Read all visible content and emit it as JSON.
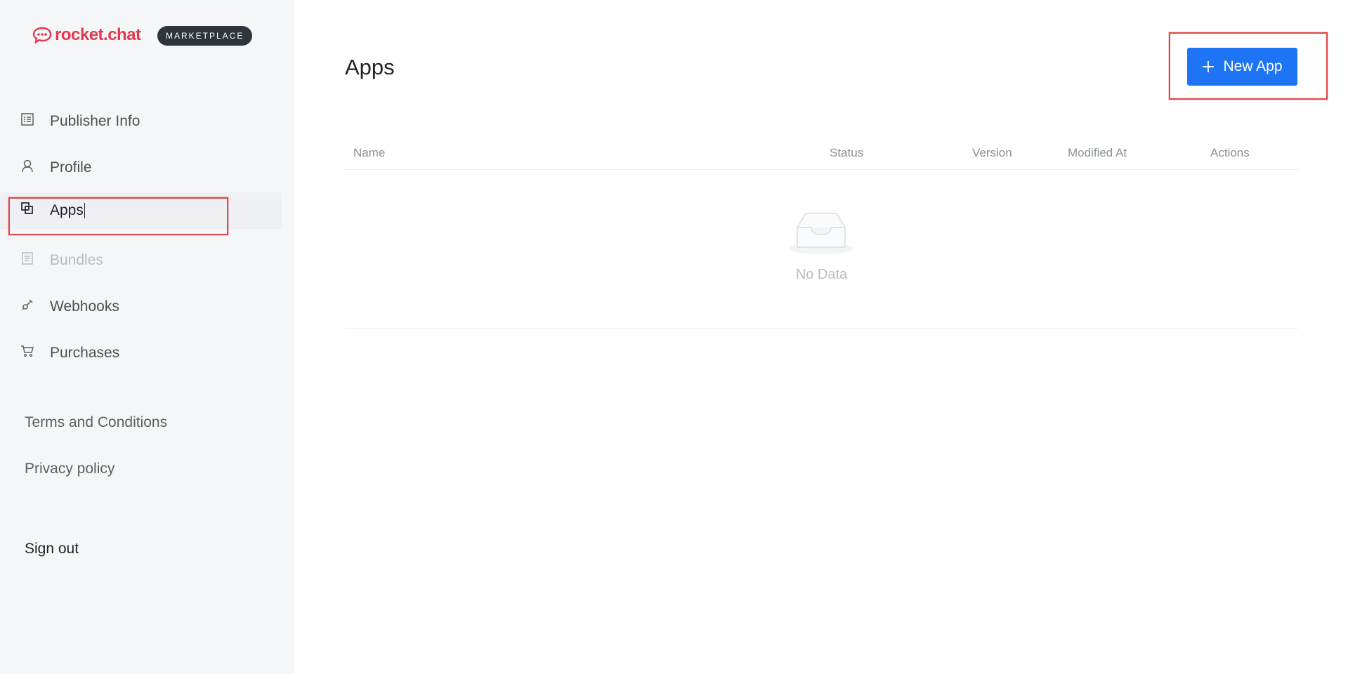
{
  "brand": {
    "logo_text": "rocket.chat",
    "badge": "MARKETPLACE",
    "accent": "#e5384f"
  },
  "sidebar": {
    "items": [
      {
        "label": "Publisher Info",
        "icon": "document-list-icon",
        "state": "normal"
      },
      {
        "label": "Profile",
        "icon": "user-icon",
        "state": "normal"
      },
      {
        "label": "Apps",
        "icon": "apps-icon",
        "state": "active"
      },
      {
        "label": "Bundles",
        "icon": "bundle-icon",
        "state": "disabled"
      },
      {
        "label": "Webhooks",
        "icon": "webhook-icon",
        "state": "normal"
      },
      {
        "label": "Purchases",
        "icon": "cart-icon",
        "state": "normal"
      }
    ],
    "terms": "Terms and Conditions",
    "privacy": "Privacy policy",
    "signout": "Sign out"
  },
  "main": {
    "title": "Apps",
    "new_app_label": "New App",
    "button_color": "#1d74f5",
    "table": {
      "columns": [
        "Name",
        "Status",
        "Version",
        "Modified At",
        "Actions"
      ],
      "rows": [],
      "empty_text": "No Data"
    }
  }
}
